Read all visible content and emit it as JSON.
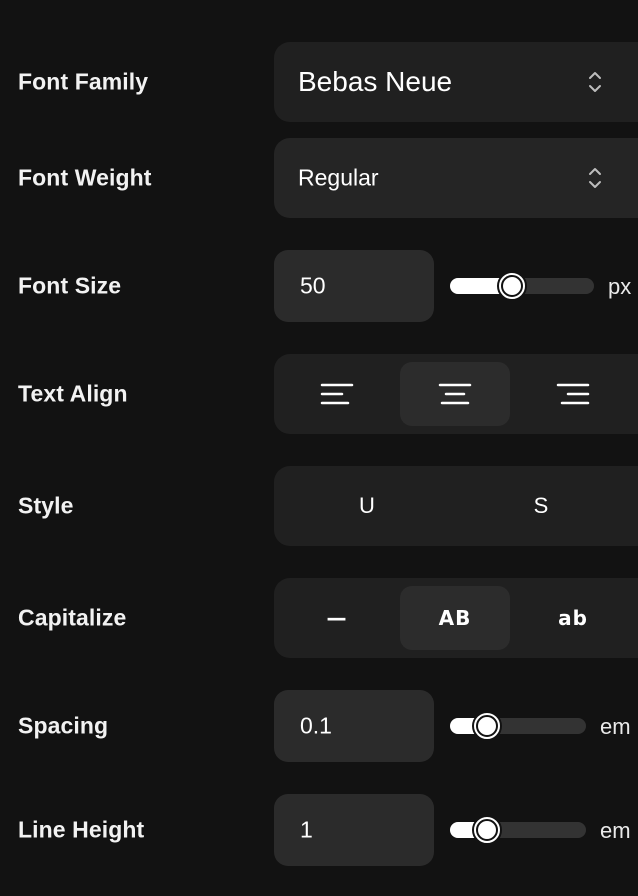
{
  "font_family": {
    "label": "Font Family",
    "value": "Bebas Neue",
    "icon": "chevron-up-down-icon"
  },
  "font_weight": {
    "label": "Font Weight",
    "value": "Regular",
    "icon": "chevron-up-down-icon"
  },
  "font_size": {
    "label": "Font Size",
    "value": "50",
    "unit": "px",
    "slider_level": 0.43
  },
  "text_align": {
    "label": "Text Align",
    "options": [
      {
        "name": "align-left-icon",
        "active": false
      },
      {
        "name": "align-center-icon",
        "active": true
      },
      {
        "name": "align-right-icon",
        "active": false
      }
    ]
  },
  "style": {
    "label": "Style",
    "options": [
      "U",
      "S"
    ]
  },
  "capitalize": {
    "label": "Capitalize",
    "options": [
      {
        "text": "—",
        "active": false
      },
      {
        "text": "AB",
        "active": true
      },
      {
        "text": "ab",
        "active": false
      }
    ]
  },
  "spacing": {
    "label": "Spacing",
    "value": "0.1",
    "unit": "em",
    "slider_level": 0.27
  },
  "line_height": {
    "label": "Line Height",
    "value": "1",
    "unit": "em",
    "slider_level": 0.27
  },
  "colors": {
    "background": "#121212",
    "control_bg": "#202020",
    "input_bg": "#2b2b2b",
    "active_bg": "#2c2c2c",
    "accent": "#ffffff"
  }
}
